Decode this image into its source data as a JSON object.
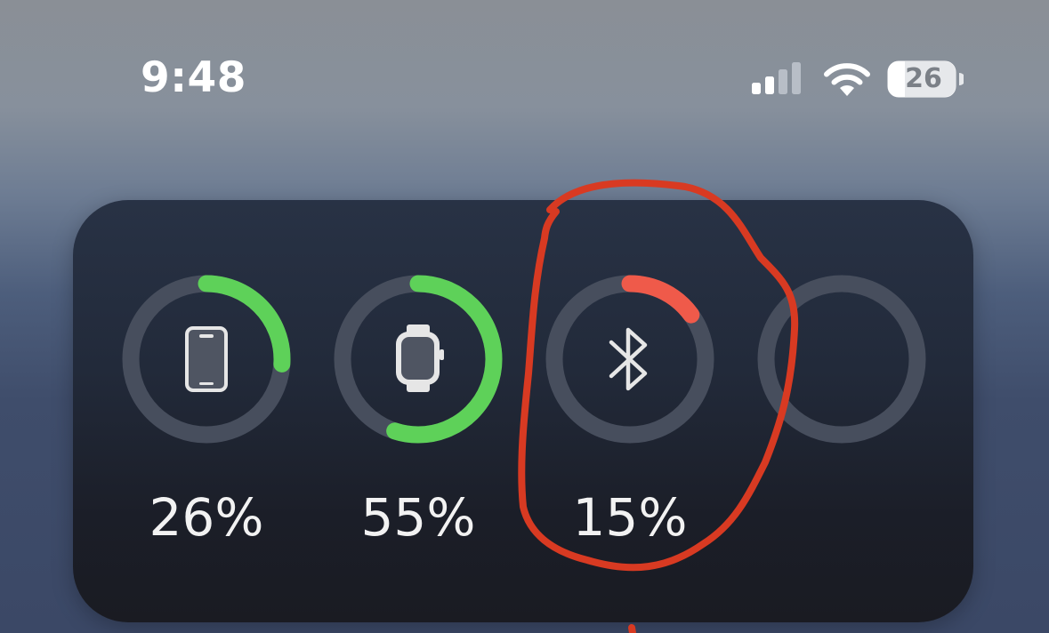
{
  "status_bar": {
    "time": "9:48",
    "battery_level": "26",
    "signal_bars_active": 2,
    "signal_bars_total": 4,
    "icons": [
      "cellular-signal-icon",
      "wifi-icon",
      "battery-icon"
    ]
  },
  "batteries_widget": {
    "devices": [
      {
        "name": "iphone",
        "icon": "iphone-icon",
        "percent_label": "26%",
        "level": 0.26,
        "ring_color": "#5ed159"
      },
      {
        "name": "apple-watch",
        "icon": "apple-watch-icon",
        "percent_label": "55%",
        "level": 0.55,
        "ring_color": "#5ed159"
      },
      {
        "name": "bluetooth-device",
        "icon": "bluetooth-icon",
        "percent_label": "15%",
        "level": 0.15,
        "ring_color": "#ef5a4a"
      },
      {
        "name": "empty-slot",
        "icon": "",
        "percent_label": "",
        "level": 0,
        "ring_color": "#4a5060"
      }
    ],
    "track_color": "#474e5d"
  },
  "annotation": {
    "type": "hand-drawn-circle",
    "color": "#d83a22",
    "target": "bluetooth-device"
  }
}
